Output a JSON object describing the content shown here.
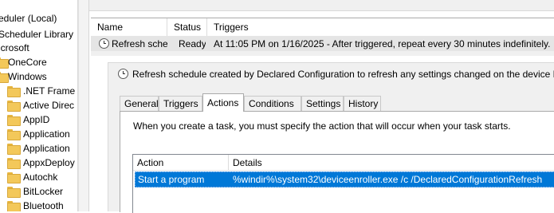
{
  "tree": {
    "items": [
      {
        "label": "eduler (Local)",
        "folder": false
      },
      {
        "label": "Scheduler Library",
        "folder": false
      },
      {
        "label": "icrosoft",
        "folder": false
      },
      {
        "label": "OneCore",
        "folder": true
      },
      {
        "label": "Windows",
        "folder": true
      },
      {
        "label": ".NET Frame",
        "folder": true
      },
      {
        "label": "Active Direc",
        "folder": true
      },
      {
        "label": "AppID",
        "folder": true
      },
      {
        "label": "Application",
        "folder": true
      },
      {
        "label": "Application",
        "folder": true
      },
      {
        "label": "AppxDeploy",
        "folder": true
      },
      {
        "label": "Autochk",
        "folder": true
      },
      {
        "label": "BitLocker",
        "folder": true
      },
      {
        "label": "Bluetooth",
        "folder": true
      }
    ]
  },
  "task_list": {
    "columns": [
      "Name",
      "Status",
      "Triggers"
    ],
    "rows": [
      {
        "name": "Refresh sche...",
        "status": "Ready",
        "trigger": "At 11:05 PM on 1/16/2025 - After triggered, repeat every 30 minutes indefinitely."
      }
    ]
  },
  "detail": {
    "title": "Refresh schedule created by Declared Configuration to refresh any settings changed on the device P",
    "tabs": [
      "General",
      "Triggers",
      "Actions",
      "Conditions",
      "Settings",
      "History"
    ],
    "active_tab": "Actions",
    "instruction": "When you create a task, you must specify the action that will occur when your task starts.",
    "actions_table": {
      "columns": [
        "Action",
        "Details"
      ],
      "rows": [
        {
          "action": "Start a program",
          "details": "%windir%\\system32\\deviceenroller.exe /c /DeclaredConfigurationRefresh"
        }
      ]
    }
  },
  "colors": {
    "selection": "#0078d7",
    "folder": "#f3c85a"
  }
}
